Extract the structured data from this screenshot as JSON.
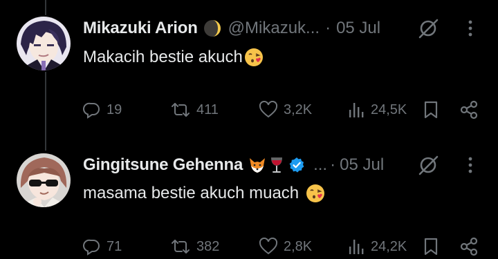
{
  "tweets": [
    {
      "name": "Mikazuki Arion",
      "name_emoji": "crescent-moon",
      "handle": "@Mikazuk...",
      "separator": "·",
      "date": "05 Jul",
      "text": "Makacih bestie akuch",
      "text_emoji": "face-blowing-kiss",
      "replies": "19",
      "reposts": "411",
      "likes": "3,2K",
      "views": "24,5K"
    },
    {
      "name": "Gingitsune Gehenna",
      "name_emojis": [
        "fox-face",
        "wine-glass"
      ],
      "verified": true,
      "handle": "...",
      "separator": "·",
      "date": "05 Jul",
      "text": "masama bestie akuch muach",
      "text_emoji": "face-blowing-kiss",
      "replies": "71",
      "reposts": "382",
      "likes": "2,8K",
      "views": "24,2K"
    }
  ],
  "colors": {
    "background": "#000000",
    "text_primary": "#e7e9ea",
    "text_secondary": "#71767b",
    "verified": "#1d9bf0",
    "thread_line": "#333639"
  }
}
